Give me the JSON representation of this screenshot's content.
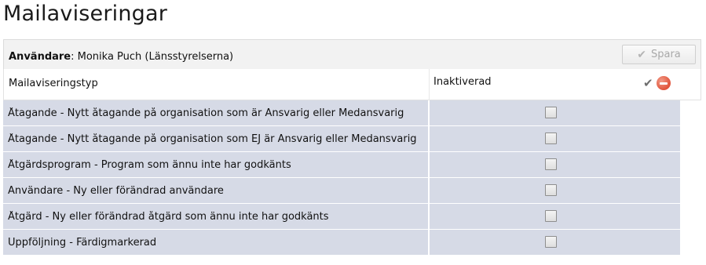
{
  "page": {
    "title": "Mailaviseringar"
  },
  "userbar": {
    "label": "Användare",
    "value": "Monika Puch (Länsstyrelserna)",
    "save_label": "Spara",
    "save_icon": "check-icon"
  },
  "table": {
    "headers": {
      "type": "Mailaviseringstyp",
      "inactive": "Inaktiverad"
    },
    "header_actions": [
      "confirm-icon",
      "remove-icon"
    ],
    "rows": [
      {
        "label": "Åtagande - Nytt åtagande på organisation som är Ansvarig eller Medansvarig",
        "inactive": false
      },
      {
        "label": "Åtagande - Nytt åtagande på organisation som EJ är Ansvarig eller Medansvarig",
        "inactive": false
      },
      {
        "label": "Åtgärdsprogram - Program som ännu inte har godkänts",
        "inactive": false
      },
      {
        "label": "Användare - Ny eller förändrad användare",
        "inactive": false
      },
      {
        "label": "Åtgärd - Ny eller förändrad åtgärd som ännu inte har godkänts",
        "inactive": false
      },
      {
        "label": "Uppföljning - Färdigmarkerad",
        "inactive": false
      }
    ]
  },
  "colors": {
    "row_background": "#d6dae6",
    "remove_icon": "#e0543b"
  }
}
